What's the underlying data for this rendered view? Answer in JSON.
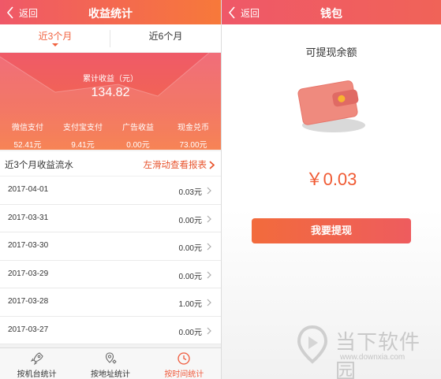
{
  "left": {
    "header": {
      "back_label": "返回",
      "title": "收益统计"
    },
    "tabs": [
      {
        "label": "近3个月",
        "active": true
      },
      {
        "label": "近6个月",
        "active": false
      }
    ],
    "summary": {
      "label": "累计收益（元）",
      "value": "134.82",
      "stats": [
        {
          "name": "微信支付",
          "value": "52.41元"
        },
        {
          "name": "支付宝支付",
          "value": "9.41元"
        },
        {
          "name": "广告收益",
          "value": "0.00元"
        },
        {
          "name": "现金兑币",
          "value": "73.00元"
        }
      ]
    },
    "flow": {
      "title": "近3个月收益流水",
      "link": "左滑动查看报表"
    },
    "rows": [
      {
        "date": "2017-04-01",
        "amount": "0.03元"
      },
      {
        "date": "2017-03-31",
        "amount": "0.00元"
      },
      {
        "date": "2017-03-30",
        "amount": "0.00元"
      },
      {
        "date": "2017-03-29",
        "amount": "0.00元"
      },
      {
        "date": "2017-03-28",
        "amount": "1.00元"
      },
      {
        "date": "2017-03-27",
        "amount": "0.00元"
      }
    ],
    "bottom_nav": [
      {
        "label": "按机台统计",
        "icon": "rocket-icon",
        "active": false
      },
      {
        "label": "按地址统计",
        "icon": "location-icon",
        "active": false
      },
      {
        "label": "按时间统计",
        "icon": "clock-icon",
        "active": true
      }
    ]
  },
  "right": {
    "header": {
      "back_label": "返回",
      "title": "钱包"
    },
    "balance_label": "可提现余额",
    "amount": "￥0.03",
    "withdraw_label": "我要提现",
    "watermark": {
      "text": "当下软件园",
      "url": "www.downxia.com"
    }
  },
  "colors": {
    "accent": "#f05a3c",
    "header_gradient_start": "#ef5868",
    "header_gradient_end": "#f7793a"
  }
}
